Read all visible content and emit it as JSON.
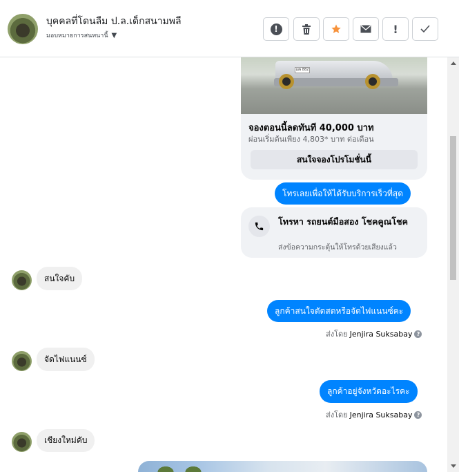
{
  "header": {
    "name": "บุคคลที่โดนลืม ป.ล.เด็กสนามพลี",
    "subtitle": "มอบหมายการสนทนานี้",
    "buttons": [
      {
        "name": "report-spam-button",
        "icon": "exclamation-circle-icon"
      },
      {
        "name": "delete-button",
        "icon": "trash-icon"
      },
      {
        "name": "star-button",
        "icon": "star-icon",
        "color": "#f7923b"
      },
      {
        "name": "mark-unread-button",
        "icon": "envelope-icon"
      },
      {
        "name": "follow-up-button",
        "icon": "exclamation-icon"
      },
      {
        "name": "mark-done-button",
        "icon": "check-icon"
      }
    ]
  },
  "promo_card": {
    "plate_text": "ฌพ 882",
    "title": "จองตอนนี้ลดทันที 40,000 บาท",
    "subtitle": "ผ่อนเริ่มต้นเพียง 4,803* บาท ต่อเดือน",
    "button": "สนใจจองโปรโมชั่นนี้"
  },
  "messages": {
    "m1": "โทรเลยเพื่อให้ได้รับบริการเร็วที่สุด",
    "call_title": "โทรหา รถยนต์มือสอง โชคคูณโชค",
    "call_sub": "ส่งข้อความกระตุ้นให้โทรด้วยเสียงแล้ว",
    "m2": "สนใจคับ",
    "m3": "ลูกค้าสนใจตัดสดหรือจัดไฟแนนซ์คะ",
    "sent_by_label": "ส่งโดย",
    "agent": "Jenjira Suksabay",
    "m4": "จัดไฟแนนซ์",
    "m5": "ลูกค้าอยู่จังหวัดอะไรคะ",
    "m6": "เชียงใหม่คับ"
  },
  "colors": {
    "outgoing_bubble": "#0084ff",
    "incoming_bubble": "#f0f0f0",
    "star": "#f7923b"
  }
}
